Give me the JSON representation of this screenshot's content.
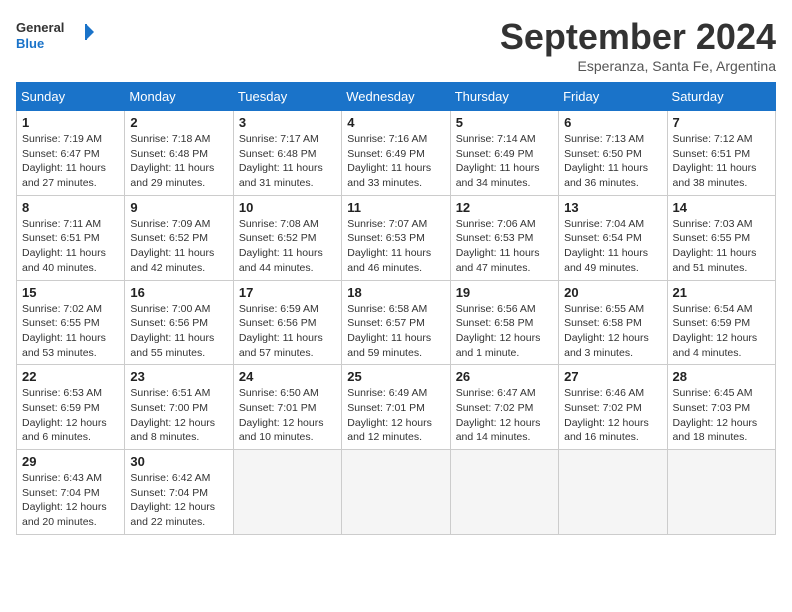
{
  "header": {
    "logo_line1": "General",
    "logo_line2": "Blue",
    "month": "September 2024",
    "location": "Esperanza, Santa Fe, Argentina"
  },
  "days_of_week": [
    "Sunday",
    "Monday",
    "Tuesday",
    "Wednesday",
    "Thursday",
    "Friday",
    "Saturday"
  ],
  "weeks": [
    [
      {
        "day": "1",
        "info": "Sunrise: 7:19 AM\nSunset: 6:47 PM\nDaylight: 11 hours\nand 27 minutes."
      },
      {
        "day": "2",
        "info": "Sunrise: 7:18 AM\nSunset: 6:48 PM\nDaylight: 11 hours\nand 29 minutes."
      },
      {
        "day": "3",
        "info": "Sunrise: 7:17 AM\nSunset: 6:48 PM\nDaylight: 11 hours\nand 31 minutes."
      },
      {
        "day": "4",
        "info": "Sunrise: 7:16 AM\nSunset: 6:49 PM\nDaylight: 11 hours\nand 33 minutes."
      },
      {
        "day": "5",
        "info": "Sunrise: 7:14 AM\nSunset: 6:49 PM\nDaylight: 11 hours\nand 34 minutes."
      },
      {
        "day": "6",
        "info": "Sunrise: 7:13 AM\nSunset: 6:50 PM\nDaylight: 11 hours\nand 36 minutes."
      },
      {
        "day": "7",
        "info": "Sunrise: 7:12 AM\nSunset: 6:51 PM\nDaylight: 11 hours\nand 38 minutes."
      }
    ],
    [
      {
        "day": "8",
        "info": "Sunrise: 7:11 AM\nSunset: 6:51 PM\nDaylight: 11 hours\nand 40 minutes."
      },
      {
        "day": "9",
        "info": "Sunrise: 7:09 AM\nSunset: 6:52 PM\nDaylight: 11 hours\nand 42 minutes."
      },
      {
        "day": "10",
        "info": "Sunrise: 7:08 AM\nSunset: 6:52 PM\nDaylight: 11 hours\nand 44 minutes."
      },
      {
        "day": "11",
        "info": "Sunrise: 7:07 AM\nSunset: 6:53 PM\nDaylight: 11 hours\nand 46 minutes."
      },
      {
        "day": "12",
        "info": "Sunrise: 7:06 AM\nSunset: 6:53 PM\nDaylight: 11 hours\nand 47 minutes."
      },
      {
        "day": "13",
        "info": "Sunrise: 7:04 AM\nSunset: 6:54 PM\nDaylight: 11 hours\nand 49 minutes."
      },
      {
        "day": "14",
        "info": "Sunrise: 7:03 AM\nSunset: 6:55 PM\nDaylight: 11 hours\nand 51 minutes."
      }
    ],
    [
      {
        "day": "15",
        "info": "Sunrise: 7:02 AM\nSunset: 6:55 PM\nDaylight: 11 hours\nand 53 minutes."
      },
      {
        "day": "16",
        "info": "Sunrise: 7:00 AM\nSunset: 6:56 PM\nDaylight: 11 hours\nand 55 minutes."
      },
      {
        "day": "17",
        "info": "Sunrise: 6:59 AM\nSunset: 6:56 PM\nDaylight: 11 hours\nand 57 minutes."
      },
      {
        "day": "18",
        "info": "Sunrise: 6:58 AM\nSunset: 6:57 PM\nDaylight: 11 hours\nand 59 minutes."
      },
      {
        "day": "19",
        "info": "Sunrise: 6:56 AM\nSunset: 6:58 PM\nDaylight: 12 hours\nand 1 minute."
      },
      {
        "day": "20",
        "info": "Sunrise: 6:55 AM\nSunset: 6:58 PM\nDaylight: 12 hours\nand 3 minutes."
      },
      {
        "day": "21",
        "info": "Sunrise: 6:54 AM\nSunset: 6:59 PM\nDaylight: 12 hours\nand 4 minutes."
      }
    ],
    [
      {
        "day": "22",
        "info": "Sunrise: 6:53 AM\nSunset: 6:59 PM\nDaylight: 12 hours\nand 6 minutes."
      },
      {
        "day": "23",
        "info": "Sunrise: 6:51 AM\nSunset: 7:00 PM\nDaylight: 12 hours\nand 8 minutes."
      },
      {
        "day": "24",
        "info": "Sunrise: 6:50 AM\nSunset: 7:01 PM\nDaylight: 12 hours\nand 10 minutes."
      },
      {
        "day": "25",
        "info": "Sunrise: 6:49 AM\nSunset: 7:01 PM\nDaylight: 12 hours\nand 12 minutes."
      },
      {
        "day": "26",
        "info": "Sunrise: 6:47 AM\nSunset: 7:02 PM\nDaylight: 12 hours\nand 14 minutes."
      },
      {
        "day": "27",
        "info": "Sunrise: 6:46 AM\nSunset: 7:02 PM\nDaylight: 12 hours\nand 16 minutes."
      },
      {
        "day": "28",
        "info": "Sunrise: 6:45 AM\nSunset: 7:03 PM\nDaylight: 12 hours\nand 18 minutes."
      }
    ],
    [
      {
        "day": "29",
        "info": "Sunrise: 6:43 AM\nSunset: 7:04 PM\nDaylight: 12 hours\nand 20 minutes."
      },
      {
        "day": "30",
        "info": "Sunrise: 6:42 AM\nSunset: 7:04 PM\nDaylight: 12 hours\nand 22 minutes."
      },
      {
        "day": "",
        "info": ""
      },
      {
        "day": "",
        "info": ""
      },
      {
        "day": "",
        "info": ""
      },
      {
        "day": "",
        "info": ""
      },
      {
        "day": "",
        "info": ""
      }
    ]
  ]
}
